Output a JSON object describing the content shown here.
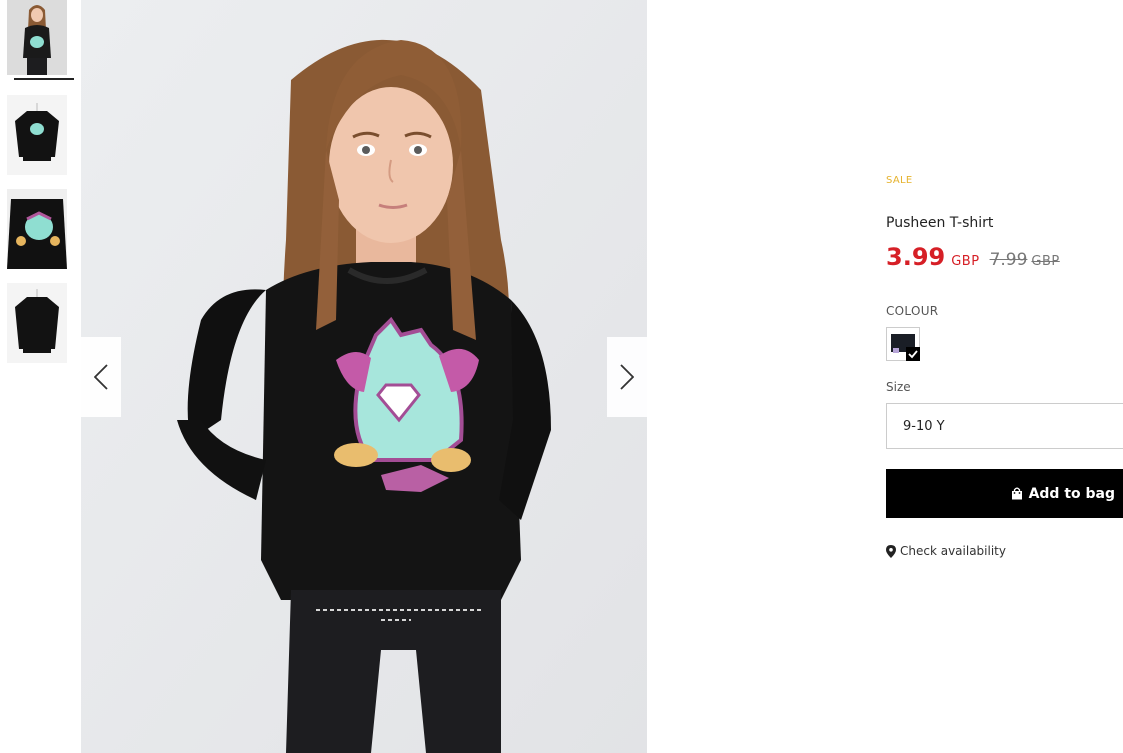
{
  "gallery": {
    "thumbnails": [
      {
        "name": "model-front"
      },
      {
        "name": "product-front"
      },
      {
        "name": "print-detail"
      },
      {
        "name": "product-back"
      }
    ],
    "active_index": 0,
    "prev_icon": "chevron-left-icon",
    "next_icon": "chevron-right-icon"
  },
  "product": {
    "badge": "SALE",
    "title": "Pusheen T-shirt",
    "price": {
      "current": "3.99",
      "current_currency": "GBP",
      "original": "7.99",
      "original_currency": "GBP"
    },
    "colour_label": "COLOUR",
    "size_label": "Size",
    "size_value": "9-10 Y",
    "add_to_bag_label": "Add to bag",
    "check_availability_label": "Check availability"
  },
  "colors": {
    "sale": "#e6b32e",
    "price": "#d61f26",
    "button_bg": "#000000",
    "garment": "#111111"
  }
}
